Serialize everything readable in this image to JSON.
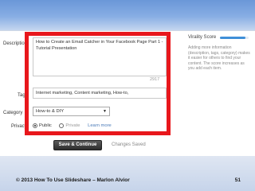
{
  "form": {
    "description_label": "Description",
    "description_value": "How to Create an Email Catcher in Your Facebook Page Part 1 - Tutorial Presentation",
    "char_count": "2917",
    "tags_label": "Tags",
    "tags_value": "Internet marketing, Content marketing, How-to,",
    "category_label": "Category",
    "category_value": "How-to & DIY",
    "privacy_label": "Privacy",
    "privacy_public": "Public",
    "privacy_private": "Private",
    "privacy_learn_more": "Learn more",
    "save_button": "Save & Continue",
    "status": "Changes Saved"
  },
  "sidebar": {
    "title": "Virality Score",
    "score_fraction": 0.9,
    "help_text": "Adding more information (description, tags, category) makes it easier for others to find your content. The score increases as you add each item."
  },
  "footer": {
    "copyright": "© 2013 How To Use Slideshare – Marlon Alvior",
    "slide_number": "51"
  },
  "colors": {
    "highlight": "#e8171c",
    "score_bar": "#3f8fd8"
  }
}
